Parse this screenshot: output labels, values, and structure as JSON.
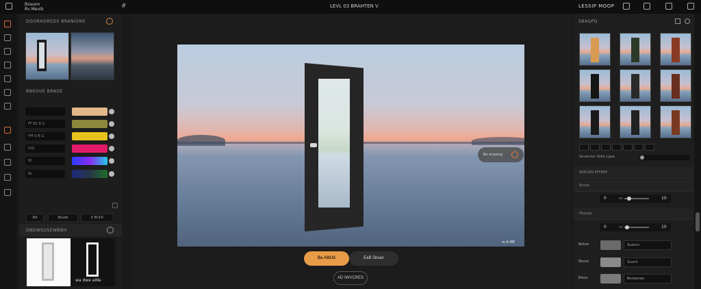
{
  "topbar": {
    "brand_line1": "Bzauno",
    "brand_line2": "Rv Mevib",
    "hash": "#",
    "title": "LEVL 03 BRAHTEN  V",
    "right_text": "LESSIP  MOOP"
  },
  "left_panel": {
    "header": "DOORHOREDS BRANIONS",
    "subheader": "BNEOUE BRADE",
    "swatches": [
      {
        "label": "",
        "color": "#e2b88a"
      },
      {
        "label": "FF  B1  B  G",
        "color": "#8c8a3a"
      },
      {
        "label": "FM  Q  B  G",
        "color": "#e7c21c"
      },
      {
        "label": "DUJ",
        "color": "#e01b6a"
      },
      {
        "label": "NI",
        "color": "linear-gradient(90deg,#2a3cff,#8a2cf0,#23c8e8)"
      },
      {
        "label": "Bs",
        "color": "linear-gradient(90deg,#1a2a7a,#28364a,#1e6e2a)"
      }
    ],
    "segments": [
      "Bd",
      "Bsusb",
      "b  Br33l"
    ],
    "section_title": "DBDWSUSEWBBH",
    "preview_caption": "wa dwe aWa"
  },
  "canvas": {
    "pill_text": "Bo ocaresq",
    "watermark": "m A ME"
  },
  "actions": {
    "primary_label": "Ba ABUS",
    "secondary_label": "EaB Sksan",
    "outline_label": "AD IWVCRES"
  },
  "right_panel": {
    "header": "Sbaqpq",
    "chip_caption": "Sevansvn Vobe Lgaa",
    "section1": "BREGRN EFFBEE",
    "section2": "Boose",
    "section3": "Pbeope",
    "slider1": {
      "left": "0",
      "mid": "es",
      "value": 0.2,
      "end": "10"
    },
    "slider2": {
      "left": "0",
      "mid": "ns",
      "value": 0.1,
      "end": "10"
    },
    "options": [
      {
        "label": "Bebse",
        "value": "Scanns",
        "swatch": "#6a6a6a"
      },
      {
        "label": "Bbose",
        "value": "Scurin",
        "swatch": "#8a8a8a"
      },
      {
        "label": "Blese",
        "value": "Boneanan",
        "swatch": "#7a7a7a"
      }
    ]
  },
  "colors": {
    "accent": "#e89c48",
    "accent_icon": "#d96a3a",
    "background": "#1a1a1a"
  }
}
